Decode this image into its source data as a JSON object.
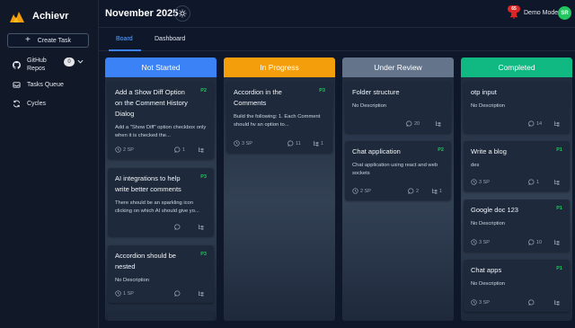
{
  "app": {
    "name": "Achievr"
  },
  "sidebar": {
    "create_label": "Create Task",
    "github_label": "GitHub Repos",
    "github_count": "0",
    "queue_label": "Tasks Queue",
    "cycles_label": "Cycles"
  },
  "header": {
    "month": "November 2025",
    "notification_count": "65",
    "mode_label": "Demo Mode",
    "avatar_initials": "SR"
  },
  "tabs": {
    "board": "Board",
    "dashboard": "Dashboard"
  },
  "colors": {
    "not_started": "#3b82f6",
    "in_progress": "#f59e0b",
    "under_review": "#64748b",
    "completed": "#10b981",
    "priority": "#22c55e"
  },
  "columns": [
    {
      "title": "Not Started",
      "cards": [
        {
          "title": "Add a Show Diff Option on the Comment History Dialog",
          "priority": "P2",
          "desc": "Add a \"Show Diff\" option checkbox only when it is checked the...",
          "sp": "2 SP",
          "comments": "1",
          "subtasks": ""
        },
        {
          "title": "AI integrations to help write better comments",
          "priority": "P3",
          "desc": "There should be an sparkling icon clicking on which AI should give yo...",
          "sp": "",
          "comments": "",
          "subtasks": ""
        },
        {
          "title": "Accordion should be nested",
          "priority": "P3",
          "desc": "No Description",
          "sp": "1 SP",
          "comments": "",
          "subtasks": ""
        }
      ]
    },
    {
      "title": "In Progress",
      "cards": [
        {
          "title": "Accordion in the Comments",
          "priority": "P3",
          "desc": "Build the following: 1. Each Comment should hv an option to...",
          "sp": "3 SP",
          "comments": "11",
          "subtasks": "1"
        }
      ]
    },
    {
      "title": "Under Review",
      "cards": [
        {
          "title": "Folder structure",
          "priority": "",
          "desc": "No Description",
          "sp": "",
          "comments": "20",
          "subtasks": ""
        },
        {
          "title": "Chat application",
          "priority": "P2",
          "desc": "Chat application using react and web sockets",
          "sp": "2 SP",
          "comments": "2",
          "subtasks": "1"
        }
      ]
    },
    {
      "title": "Completed",
      "cards": [
        {
          "title": "otp input",
          "priority": "",
          "desc": "No Description",
          "sp": "",
          "comments": "14",
          "subtasks": ""
        },
        {
          "title": "Write a blog",
          "priority": "P1",
          "desc": "des",
          "sp": "3 SP",
          "comments": "1",
          "subtasks": ""
        },
        {
          "title": "Google doc 123",
          "priority": "P1",
          "desc": "No Description",
          "sp": "3 SP",
          "comments": "10",
          "subtasks": ""
        },
        {
          "title": "Chat apps",
          "priority": "P1",
          "desc": "No Description",
          "sp": "3 SP",
          "comments": "",
          "subtasks": ""
        }
      ]
    }
  ]
}
